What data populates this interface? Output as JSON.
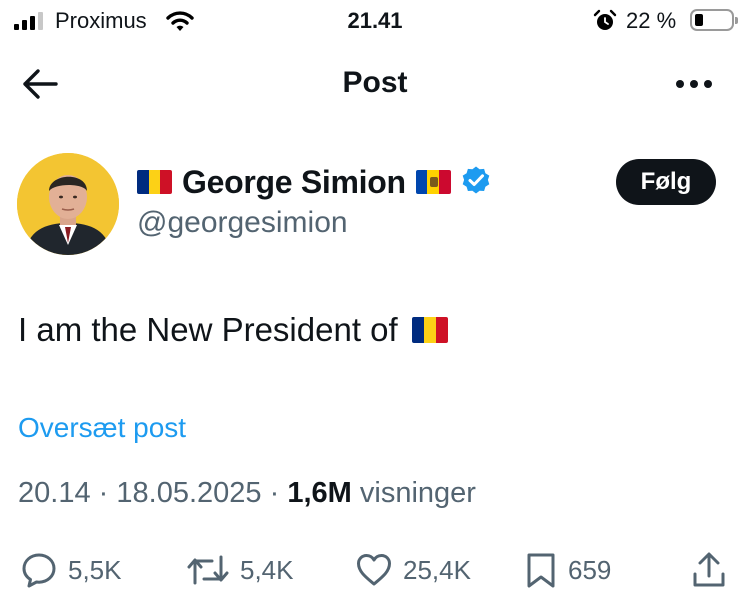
{
  "status_bar": {
    "carrier": "Proximus",
    "time": "21.41",
    "battery_percent": "22 %",
    "battery_level": 0.22
  },
  "nav": {
    "title": "Post",
    "back_icon": "arrow-left-icon",
    "more_icon": "more-horizontal-icon"
  },
  "author": {
    "display_name": "George Simion",
    "handle": "@georgesimion",
    "verified": true,
    "follow_label": "Følg"
  },
  "post": {
    "text": "I am the New President of",
    "translate_label": "Oversæt post",
    "time": "20.14",
    "date": "18.05.2025",
    "separator": "·",
    "views_count": "1,6M",
    "views_label": "visninger"
  },
  "actions": {
    "replies": "5,5K",
    "reposts": "5,4K",
    "likes": "25,4K",
    "bookmarks": "659"
  },
  "colors": {
    "accent_blue": "#1d9bf0",
    "text_primary": "#0f1419",
    "text_secondary": "#536471",
    "romania_flag": [
      "#002b7f",
      "#fcd116",
      "#ce1126"
    ],
    "moldova_flag": [
      "#0046ae",
      "#ffd200",
      "#cc092f"
    ]
  }
}
